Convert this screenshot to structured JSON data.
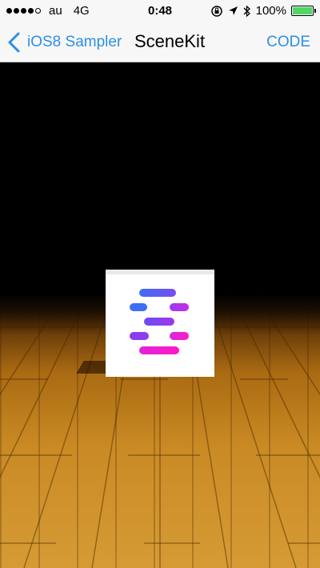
{
  "status_bar": {
    "carrier": "au",
    "network": "4G",
    "time": "0:48",
    "battery": "100%",
    "battery_level": 1.0,
    "signal_bars_filled": 4,
    "signal_bars_total": 5
  },
  "nav": {
    "back_label": "iOS8 Sampler",
    "title": "SceneKit",
    "code_label": "CODE"
  },
  "colors": {
    "tint": "#2d8ee6",
    "battery_fill": "#4cd964",
    "logo_gradient_start": "#3b6ff5",
    "logo_gradient_end": "#ff19c7"
  },
  "icons": {
    "back": "chevron-left-icon",
    "orientation_lock": "orientation-lock-icon",
    "location": "location-arrow-icon",
    "bluetooth": "bluetooth-icon",
    "battery": "battery-icon"
  }
}
